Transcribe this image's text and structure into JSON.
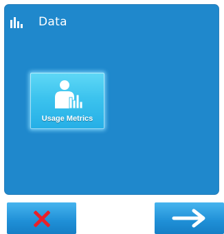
{
  "header": {
    "title": "Data",
    "icon": "bar-chart-icon"
  },
  "tiles": [
    {
      "label": "Usage Metrics",
      "icon": "user-chart-icon"
    }
  ],
  "footer": {
    "cancel_icon": "close-icon",
    "next_icon": "arrow-right-icon"
  },
  "colors": {
    "panel": "#1f88cc",
    "tile": "#3cc3ee",
    "cancel": "#e8202a",
    "white": "#ffffff"
  }
}
